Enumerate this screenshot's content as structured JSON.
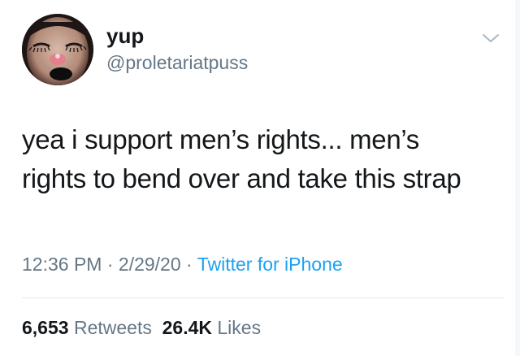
{
  "author": {
    "display_name": "yup",
    "handle": "@proletariatpuss",
    "avatar_icon": "profile-avatar"
  },
  "menu_icon": "chevron-down-icon",
  "tweet": {
    "lines": [
      "yea i support men’s rights... men’s",
      "rights to bend over and take this strap"
    ]
  },
  "meta": {
    "time": "12:36 PM",
    "separator": "·",
    "date": "2/29/20",
    "source": "Twitter for iPhone"
  },
  "stats": {
    "retweets_count": "6,653",
    "retweets_label": "Retweets",
    "likes_count": "26.4K",
    "likes_label": "Likes"
  },
  "colors": {
    "text_primary": "#14171a",
    "text_secondary": "#657786",
    "link": "#1da1f2",
    "divider": "#e1e8ed"
  }
}
